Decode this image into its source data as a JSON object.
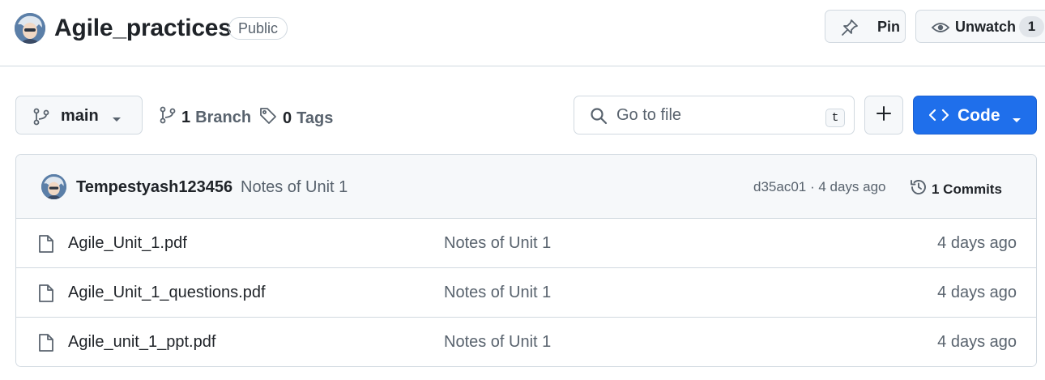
{
  "repo": {
    "name": "Agile_practices",
    "visibility": "Public"
  },
  "header_actions": {
    "pin_label": "Pin",
    "unwatch_label": "Unwatch",
    "watch_count": "1"
  },
  "toolbar": {
    "branch": "main",
    "branches_count": "1",
    "branches_label": "Branch",
    "tags_count": "0",
    "tags_label": "Tags",
    "search_placeholder": "Go to file",
    "search_shortcut": "t",
    "code_label": "Code"
  },
  "latest_commit": {
    "author": "Tempestyash123456",
    "message": "Notes of Unit 1",
    "meta": "d35ac01 · 4 days ago",
    "commits_label": "1 Commits"
  },
  "files": [
    {
      "name": "Agile_Unit_1.pdf",
      "commit": "Notes of Unit 1",
      "age": "4 days ago"
    },
    {
      "name": "Agile_Unit_1_questions.pdf",
      "commit": "Notes of Unit 1",
      "age": "4 days ago"
    },
    {
      "name": "Agile_unit_1_ppt.pdf",
      "commit": "Notes of Unit 1",
      "age": "4 days ago"
    }
  ],
  "icons": {
    "pin": "pin-icon",
    "eye": "eye-icon",
    "branch": "git-branch-icon",
    "tag": "tag-icon",
    "search": "search-icon",
    "plus": "plus-icon",
    "code": "code-icon",
    "history": "history-icon",
    "file": "file-icon"
  },
  "colors": {
    "accent": "#1f6feb",
    "text": "#1f2328",
    "muted": "#59636e",
    "border": "#d1d9e0"
  }
}
